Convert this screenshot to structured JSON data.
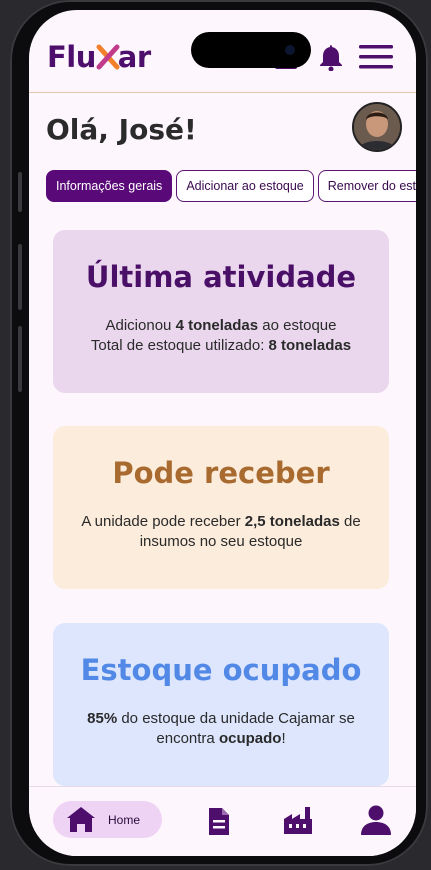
{
  "brand": {
    "part1": "Flu",
    "part2": "X",
    "part3": "ar"
  },
  "greeting": "Olá, José!",
  "tabs": [
    {
      "label": "Informações gerais",
      "active": true
    },
    {
      "label": "Adicionar ao estoque",
      "active": false
    },
    {
      "label": "Remover do estoq",
      "active": false
    }
  ],
  "cards": {
    "last_activity": {
      "title": "Última atividade",
      "line1_pre": "Adicionou ",
      "line1_bold": "4 toneladas",
      "line1_post": " ao estoque",
      "line2_pre": "Total de estoque utilizado: ",
      "line2_bold": "8 toneladas"
    },
    "can_receive": {
      "title": "Pode receber",
      "line1_pre": "A unidade pode receber ",
      "line1_bold": "2,5 toneladas",
      "line1_post": " de",
      "line2": "insumos no seu estoque"
    },
    "stock_occupied": {
      "title": "Estoque ocupado",
      "line1_bold": "85%",
      "line1_post": " do estoque da unidade Cajamar se",
      "line2_pre": "encontra ",
      "line2_bold": "ocupado",
      "line2_post": "!"
    }
  },
  "bottom_nav": {
    "home_label": "Home"
  },
  "icons": [
    "calendar-icon",
    "bell-icon",
    "menu-icon",
    "home-icon",
    "document-icon",
    "factory-icon",
    "person-icon"
  ],
  "colors": {
    "brand_purple": "#4d0f6b",
    "active_tab": "#5a0a78",
    "orange_title": "#a86a2f",
    "blue_title": "#5288e6"
  }
}
